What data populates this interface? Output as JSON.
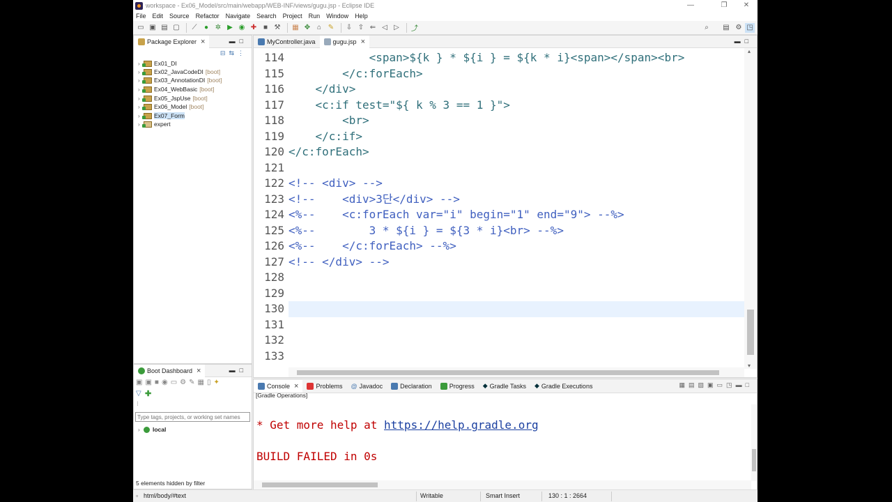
{
  "window": {
    "title": "workspace - Ex06_Model/src/main/webapp/WEB-INF/views/gugu.jsp - Eclipse IDE",
    "min_glyph": "—",
    "max_glyph": "❐",
    "close_glyph": "✕"
  },
  "menu": [
    "File",
    "Edit",
    "Source",
    "Refactor",
    "Navigate",
    "Search",
    "Project",
    "Run",
    "Window",
    "Help"
  ],
  "package_explorer": {
    "tab_label": "Package Explorer",
    "projects": [
      {
        "name": "Ex01_DI",
        "tag": ""
      },
      {
        "name": "Ex02_JavaCodeDI",
        "tag": "[boot]"
      },
      {
        "name": "Ex03_AnnotationDI",
        "tag": "[boot]"
      },
      {
        "name": "Ex04_WebBasic",
        "tag": "[boot]"
      },
      {
        "name": "Ex05_JspUse",
        "tag": "[boot]"
      },
      {
        "name": "Ex06_Model",
        "tag": "[boot]"
      },
      {
        "name": "Ex07_Form",
        "tag": ""
      },
      {
        "name": "expert",
        "tag": ""
      }
    ]
  },
  "boot_dashboard": {
    "tab_label": "Boot Dashboard",
    "filter_placeholder": "Type tags, projects, or working set names",
    "local_label": "local",
    "hidden_note": "5 elements hidden by filter"
  },
  "editor": {
    "tabs": [
      "MyController.java",
      "gugu.jsp"
    ],
    "lines": [
      {
        "num": "114",
        "text": "            <span>${k } * ${i } = ${k * i}<span></span><br>"
      },
      {
        "num": "115",
        "text": "        </c:forEach>"
      },
      {
        "num": "116",
        "text": "    </div>"
      },
      {
        "num": "117",
        "text": "    <c:if test=\"${ k % 3 == 1 }\">"
      },
      {
        "num": "118",
        "text": "        <br>"
      },
      {
        "num": "119",
        "text": "    </c:if>"
      },
      {
        "num": "120",
        "text": "</c:forEach>"
      },
      {
        "num": "121",
        "text": ""
      },
      {
        "num": "122",
        "text": "<!-- <div> -->"
      },
      {
        "num": "123",
        "text": "<!--    <div>3단</div> -->"
      },
      {
        "num": "124",
        "text": "<%--    <c:forEach var=\"i\" begin=\"1\" end=\"9\"> --%>"
      },
      {
        "num": "125",
        "text": "<%--        3 * ${i } = ${3 * i}<br> --%>"
      },
      {
        "num": "126",
        "text": "<%--    </c:forEach> --%>"
      },
      {
        "num": "127",
        "text": "<!-- </div> -->"
      },
      {
        "num": "128",
        "text": ""
      },
      {
        "num": "129",
        "text": ""
      },
      {
        "num": "130",
        "text": ""
      },
      {
        "num": "131",
        "text": ""
      },
      {
        "num": "132",
        "text": ""
      },
      {
        "num": "133",
        "text": ""
      }
    ]
  },
  "console": {
    "tabs": [
      "Console",
      "Problems",
      "Javadoc",
      "Declaration",
      "Progress",
      "Gradle Tasks",
      "Gradle Executions"
    ],
    "subtitle": "[Gradle Operations]",
    "help_prefix": "* Get more help at ",
    "help_link": "https://help.gradle.org",
    "build_result": "BUILD FAILED in 0s"
  },
  "status": {
    "path": "html/body/#text",
    "mode": "Writable",
    "insert": "Smart Insert",
    "position": "130 : 1 : 2664"
  }
}
